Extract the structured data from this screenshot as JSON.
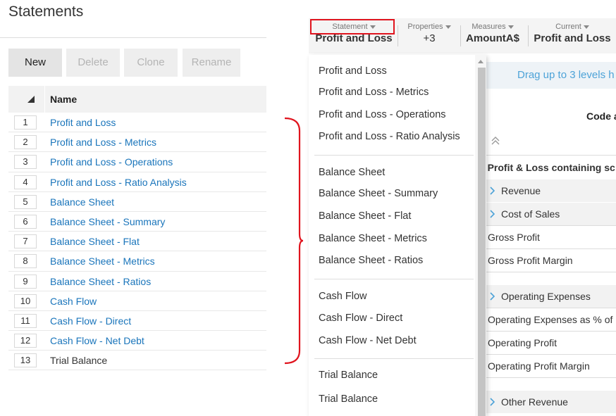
{
  "left": {
    "title": "Statements",
    "buttons": {
      "new": "New",
      "delete": "Delete",
      "clone": "Clone",
      "rename": "Rename"
    },
    "table": {
      "column_name": "Name",
      "rows": [
        {
          "num": "1",
          "label": "Profit and Loss"
        },
        {
          "num": "2",
          "label": "Profit and Loss - Metrics"
        },
        {
          "num": "3",
          "label": "Profit and Loss - Operations"
        },
        {
          "num": "4",
          "label": "Profit and Loss - Ratio Analysis"
        },
        {
          "num": "5",
          "label": "Balance Sheet"
        },
        {
          "num": "6",
          "label": "Balance Sheet - Summary"
        },
        {
          "num": "7",
          "label": "Balance Sheet - Flat"
        },
        {
          "num": "8",
          "label": "Balance Sheet - Metrics"
        },
        {
          "num": "9",
          "label": "Balance Sheet - Ratios"
        },
        {
          "num": "10",
          "label": "Cash Flow"
        },
        {
          "num": "11",
          "label": "Cash Flow - Direct"
        },
        {
          "num": "12",
          "label": "Cash Flow - Net Debt"
        },
        {
          "num": "13",
          "label": "Trial Balance"
        }
      ]
    }
  },
  "toolbar": {
    "statement": {
      "caption": "Statement",
      "value": "Profit and Loss"
    },
    "properties": {
      "caption": "Properties",
      "value": "+3"
    },
    "measures": {
      "caption": "Measures",
      "value": "AmountA$"
    },
    "current": {
      "caption": "Current",
      "value": "Profit and Loss"
    }
  },
  "dropdown": {
    "items": [
      "Profit and Loss",
      "Profit and Loss - Metrics",
      "Profit and Loss - Operations",
      "Profit and Loss - Ratio Analysis",
      "Balance Sheet",
      "Balance Sheet - Summary",
      "Balance Sheet - Flat",
      "Balance Sheet - Metrics",
      "Balance Sheet - Ratios",
      "Cash Flow",
      "Cash Flow - Direct",
      "Cash Flow - Net Debt",
      "Trial Balance",
      "Trial Balance"
    ]
  },
  "report": {
    "banner": "Drag up to 3 levels h",
    "code_header": "Code a",
    "group_title": "al Profit & Loss containing sc",
    "rows": [
      "Revenue",
      "Cost of Sales",
      "Gross Profit",
      "Gross Profit Margin",
      "Operating Expenses",
      "Operating Expenses as % of R",
      "Operating Profit",
      "Operating Profit Margin",
      "Other Revenue"
    ]
  },
  "colors": {
    "link": "#1a75bb",
    "highlight": "#e0141e",
    "banner_text": "#4da3d8"
  }
}
